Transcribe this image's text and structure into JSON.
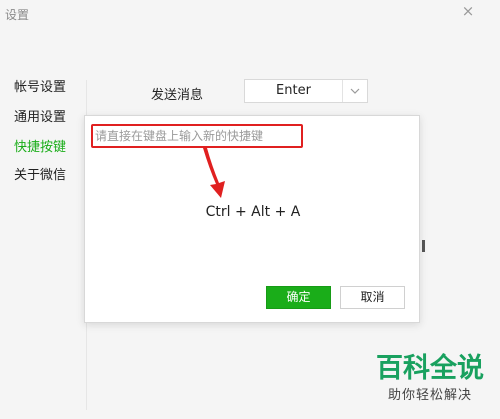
{
  "window": {
    "title": "设置",
    "close_glyph": "×"
  },
  "sidebar": {
    "items": [
      {
        "label": "帐号设置",
        "active": false
      },
      {
        "label": "通用设置",
        "active": false
      },
      {
        "label": "快捷按键",
        "active": true
      },
      {
        "label": "关于微信",
        "active": false
      }
    ],
    "active_color": "#1aad19"
  },
  "settings": {
    "send_message_label": "发送消息",
    "send_message_value": "Enter"
  },
  "dialog": {
    "hint": "请直接在键盘上输入新的快捷键",
    "shortcut": "Ctrl + Alt + A",
    "confirm_label": "确定",
    "cancel_label": "取消"
  },
  "annotation": {
    "color": "#e02020"
  },
  "watermark": {
    "title": "百科全说",
    "subtitle": "助你轻松解决",
    "color": "#19a15f"
  },
  "icons": {
    "close": "close-icon",
    "dropdown": "chevron-down-icon",
    "arrow": "red-arrow-annotation-icon"
  }
}
